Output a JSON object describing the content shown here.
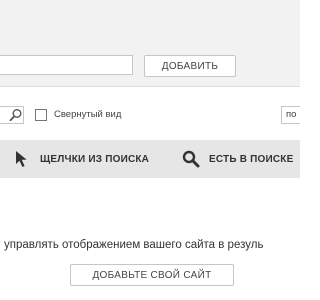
{
  "add_panel": {
    "site_input_value": "",
    "add_button_label": "ДОБАВИТЬ"
  },
  "filter": {
    "search_icon": "search-icon",
    "collapse_label": "Свернутый вид",
    "sort_value": "по"
  },
  "columns": {
    "clicks": {
      "label": "ЩЕЛЧКИ ИЗ ПОИСКА",
      "icon": "cursor-arrow-icon"
    },
    "indexed": {
      "label": "ЕСТЬ В ПОИСКЕ",
      "icon": "magnifier-icon"
    }
  },
  "empty_state": {
    "message": "управлять отображением вашего сайта в резуль",
    "button_label": "ДОБАВЬТЕ СВОЙ САЙТ"
  },
  "colors": {
    "panel_bg": "#f2f2f2",
    "columns_bg": "#e6e6e6",
    "border": "#c6c6c6",
    "text": "#333333"
  }
}
